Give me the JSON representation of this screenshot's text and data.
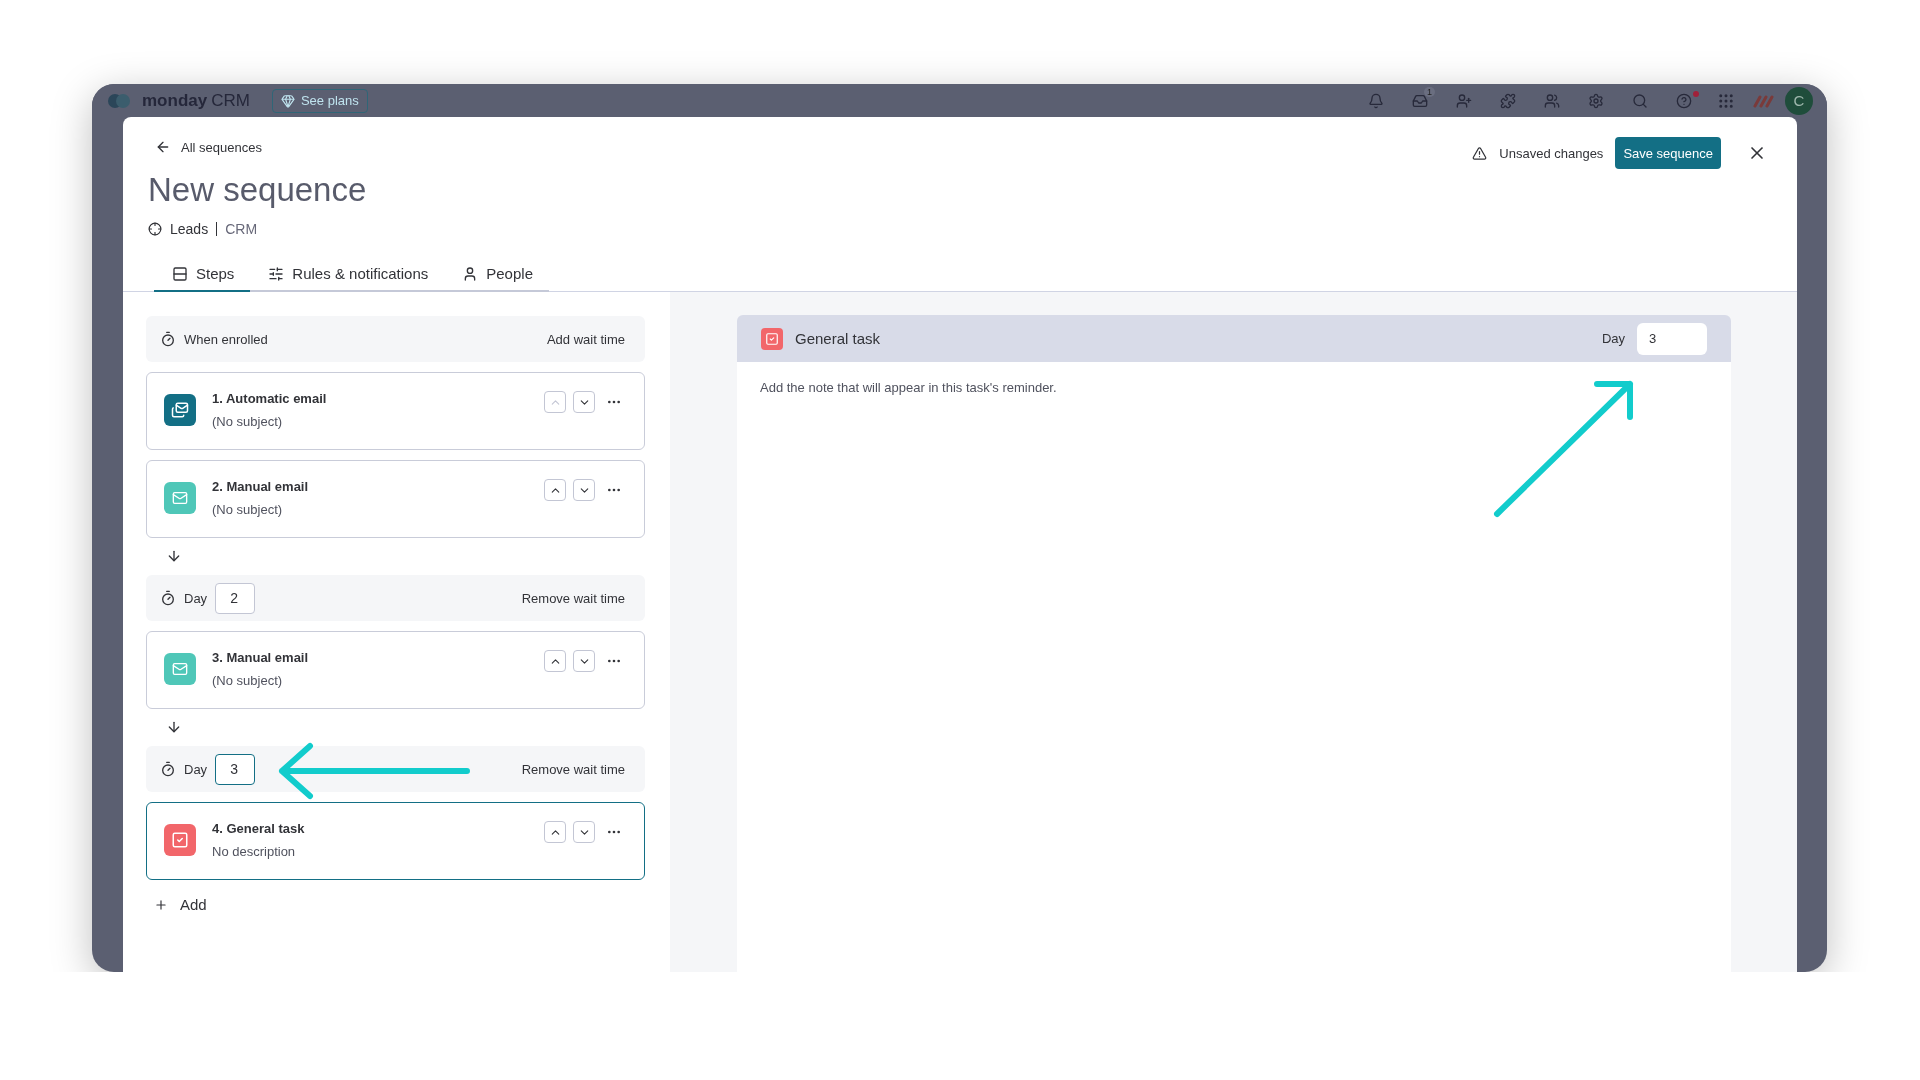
{
  "app_bar": {
    "logo_text": "monday",
    "product": "CRM",
    "plans_button": "See plans",
    "inbox_badge": "1",
    "avatar": "C"
  },
  "modal": {
    "back_link": "All sequences",
    "title": "New sequence",
    "board": "Leads",
    "workspace": "CRM",
    "status": "Unsaved changes",
    "save_button": "Save sequence"
  },
  "tabs": [
    {
      "label": "Steps",
      "selected": true
    },
    {
      "label": "Rules & notifications",
      "selected": false
    },
    {
      "label": "People",
      "selected": false
    }
  ],
  "steps": [
    {
      "kind": "start",
      "label": "When enrolled",
      "action": "Add wait time"
    },
    {
      "kind": "automatic_email",
      "title": "1. Automatic email",
      "subtitle": "(No subject)",
      "up_enabled": false,
      "selected": false
    },
    {
      "kind": "manual_email",
      "title": "2. Manual email",
      "subtitle": "(No subject)",
      "up_enabled": true,
      "selected": false
    },
    {
      "kind": "wait",
      "label": "Day",
      "value": "2",
      "focused": false,
      "action": "Remove wait time"
    },
    {
      "kind": "manual_email",
      "title": "3. Manual email",
      "subtitle": "(No subject)",
      "up_enabled": true,
      "selected": false
    },
    {
      "kind": "wait",
      "label": "Day",
      "value": "3",
      "focused": true,
      "action": "Remove wait time"
    },
    {
      "kind": "task",
      "title": "4. General task",
      "subtitle": "No description",
      "up_enabled": true,
      "selected": true
    }
  ],
  "add_button": "Add",
  "detail": {
    "title": "General task",
    "day_label": "Day",
    "day_value": "3",
    "placeholder": "Add the note that will appear in this task's reminder."
  }
}
